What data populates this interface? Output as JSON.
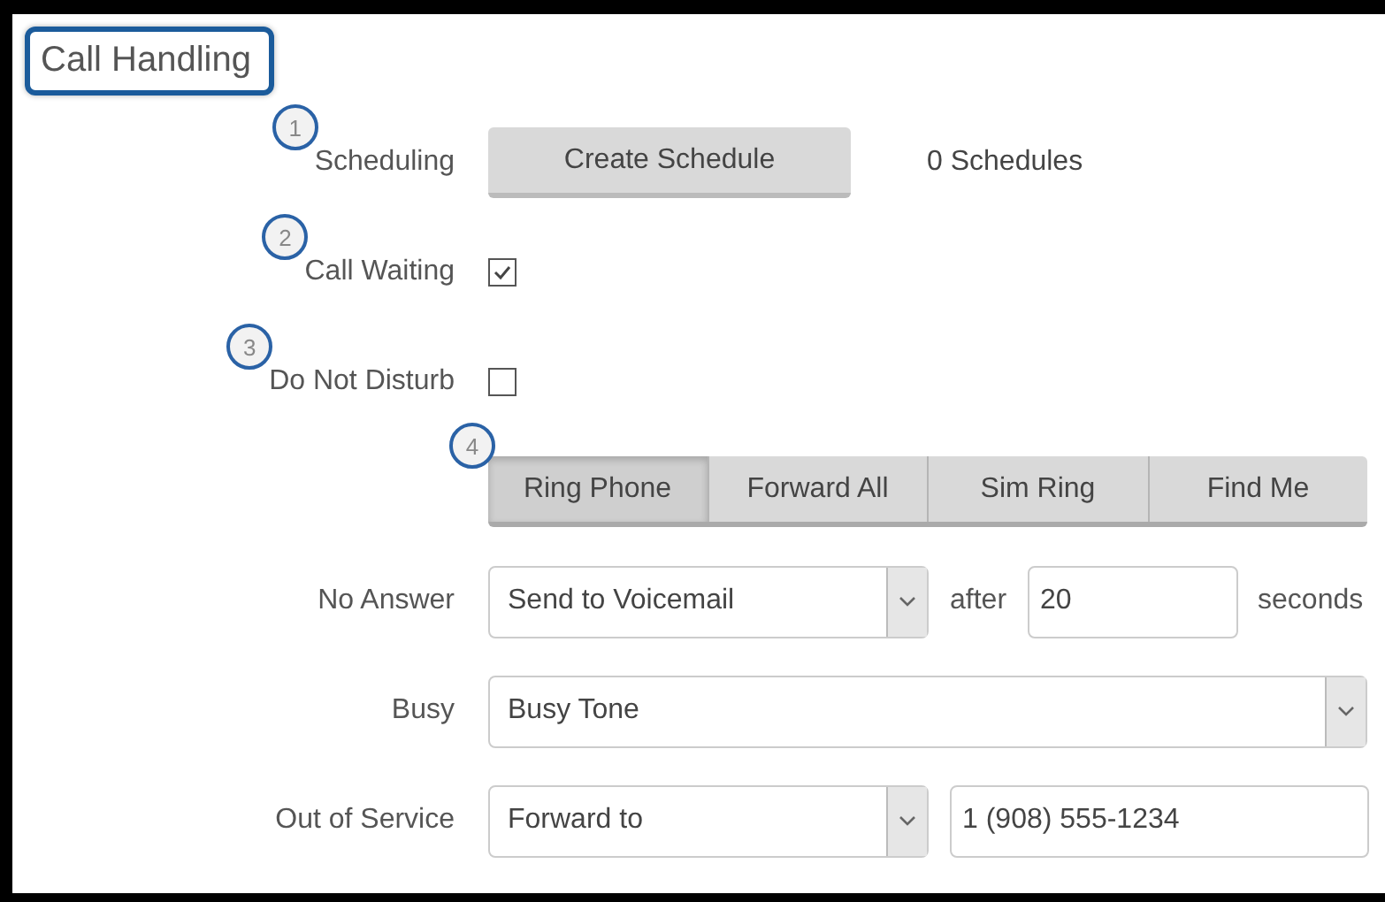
{
  "title": "Call Handling",
  "scheduling": {
    "callout": "1",
    "label": "Scheduling",
    "button": "Create Schedule",
    "count": "0 Schedules"
  },
  "call_waiting": {
    "callout": "2",
    "label": "Call Waiting",
    "checked": true
  },
  "do_not_disturb": {
    "callout": "3",
    "label": "Do Not Disturb",
    "checked": false
  },
  "mode_tabs": {
    "callout": "4",
    "tabs": [
      {
        "label": "Ring Phone",
        "selected": true
      },
      {
        "label": "Forward All",
        "selected": false
      },
      {
        "label": "Sim Ring",
        "selected": false
      },
      {
        "label": "Find Me",
        "selected": false
      }
    ]
  },
  "no_answer": {
    "label": "No Answer",
    "select": "Send to Voicemail",
    "after": "after",
    "value": "20",
    "unit": "seconds"
  },
  "busy": {
    "label": "Busy",
    "select": "Busy Tone"
  },
  "out_of_service": {
    "label": "Out of Service",
    "select": "Forward to",
    "value": "1 (908) 555-1234"
  }
}
